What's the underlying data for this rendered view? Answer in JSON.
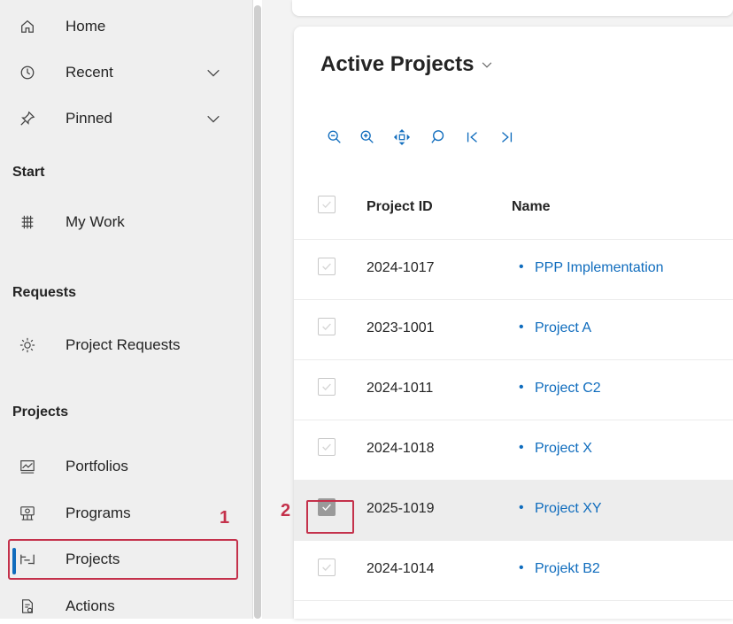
{
  "sidebar": {
    "items": [
      {
        "label": "Home",
        "icon": "home-icon"
      },
      {
        "label": "Recent",
        "icon": "clock-icon",
        "expandable": true
      },
      {
        "label": "Pinned",
        "icon": "pin-icon",
        "expandable": true
      }
    ],
    "sections": [
      {
        "title": "Start",
        "items": [
          {
            "label": "My Work",
            "icon": "my-work-icon"
          }
        ]
      },
      {
        "title": "Requests",
        "items": [
          {
            "label": "Project Requests",
            "icon": "lightbulb-icon"
          }
        ]
      },
      {
        "title": "Projects",
        "items": [
          {
            "label": "Portfolios",
            "icon": "portfolio-icon"
          },
          {
            "label": "Programs",
            "icon": "programs-icon"
          },
          {
            "label": "Projects",
            "icon": "projects-icon",
            "active": true
          },
          {
            "label": "Actions",
            "icon": "actions-icon"
          }
        ]
      }
    ]
  },
  "annotations": {
    "marker1": "1",
    "marker2": "2",
    "color": "#c4314b"
  },
  "view": {
    "title": "Active Projects",
    "toolbar": [
      "zoom-out-icon",
      "zoom-in-icon",
      "pan-icon",
      "search-icon",
      "first-page-icon",
      "last-page-icon"
    ],
    "columns": {
      "id": "Project ID",
      "name": "Name"
    },
    "rows": [
      {
        "id": "2024-1017",
        "name": "PPP Implementation",
        "checked": false
      },
      {
        "id": "2023-1001",
        "name": "Project A",
        "checked": false
      },
      {
        "id": "2024-1011",
        "name": "Project C2",
        "checked": false
      },
      {
        "id": "2024-1018",
        "name": "Project X",
        "checked": false
      },
      {
        "id": "2025-1019",
        "name": "Project XY",
        "checked": true
      },
      {
        "id": "2024-1014",
        "name": "Projekt B2",
        "checked": false
      }
    ],
    "bullet": "•"
  },
  "colors": {
    "accent": "#0f6cbd",
    "highlight": "#c4314b",
    "sidebar_bg": "#efefef"
  }
}
